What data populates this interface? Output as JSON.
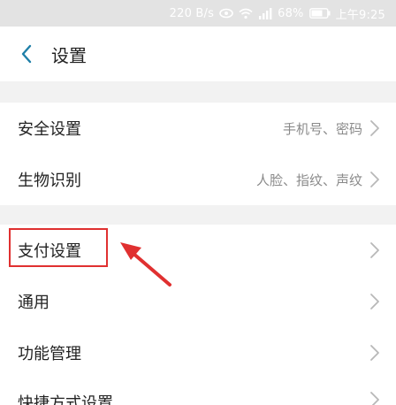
{
  "status_bar": {
    "speed": "220 B/s",
    "battery": "68%",
    "time": "上午9:25"
  },
  "header": {
    "title": "设置"
  },
  "sections": [
    {
      "items": [
        {
          "label": "安全设置",
          "value": "手机号、密码"
        },
        {
          "label": "生物识别",
          "value": "人脸、指纹、声纹"
        }
      ]
    },
    {
      "items": [
        {
          "label": "支付设置",
          "value": ""
        },
        {
          "label": "通用",
          "value": ""
        },
        {
          "label": "功能管理",
          "value": ""
        },
        {
          "label": "快捷方式设置",
          "value": ""
        }
      ]
    }
  ],
  "colors": {
    "accent": "#1f7fa8",
    "annotation": "#e03030",
    "band": "#f2f2f2"
  }
}
